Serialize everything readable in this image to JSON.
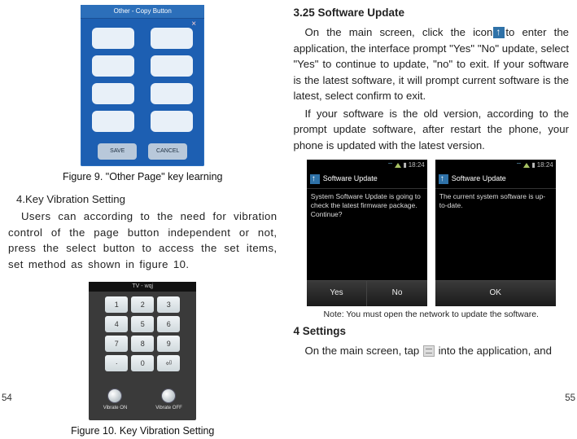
{
  "left": {
    "fig9_caption": "Figure 9. \"Other Page\" key learning",
    "fig9_title": "Other - Copy Button",
    "fig9_save": "SAVE",
    "fig9_cancel": "CANCEL",
    "s4_title": "4.Key Vibration Setting",
    "s4_body": "Users can according to the need for vibration control of the page button independent or not, press the select button to access the set items, set method as shown in figure 10.",
    "fig10_caption": "Figure 10. Key Vibration Setting",
    "fig10_title": "TV - wqj",
    "fig10_keys": [
      "1",
      "2",
      "3",
      "4",
      "5",
      "6",
      "7",
      "8",
      "9",
      "·",
      "0",
      "⏎"
    ],
    "fig10_toggle_on": "Vibrate ON",
    "fig10_toggle_off": "Vibrate OFF",
    "page_number": "54"
  },
  "right": {
    "h325": "3.25  Software Update",
    "p1_a": "On the main screen, click the icon",
    "p1_b": "to enter the application, the interface prompt \"Yes\" \"No\" update, select \"Yes\" to continue to update, \"no\" to exit. If your software is the latest software, it will prompt current software is the latest, select confirm to exit.",
    "p2": "If your software is the old version, according to the prompt update software, after restart the phone, your phone is updated with the latest version.",
    "shot_time": "18:24",
    "shot_hdr": "Software Update",
    "shot1_body": "System Software Update is going to check the latest firmware package. Continue?",
    "shot2_body": "The current system software is up-to-date.",
    "btn_yes": "Yes",
    "btn_no": "No",
    "btn_ok": "OK",
    "note": "Note: You must open the network to update the software.",
    "h4": "4  Settings",
    "p4_a": "On the main screen, tap",
    "p4_b": "into the application, and",
    "page_number": "55"
  }
}
